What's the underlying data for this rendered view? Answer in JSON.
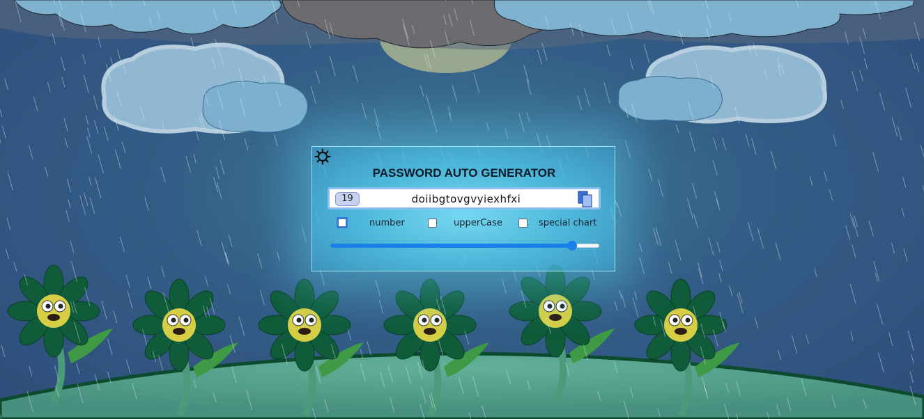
{
  "app": {
    "title": "PASSWORD AUTO GENERATOR",
    "password": "doiibgtovgvyiexhfxi",
    "length": "19",
    "slider_value": 0.9
  },
  "options": [
    {
      "label": "number",
      "checked": false
    },
    {
      "label": "upperCase",
      "checked": false
    },
    {
      "label": "special chart",
      "checked": false
    }
  ],
  "icons": {
    "settings": "gear-icon",
    "copy": "copy-icon"
  },
  "colors": {
    "panel_glow": "#5cc8ea",
    "slider_accent": "#1a7fe8",
    "flower_petal": "#0f5b3a",
    "hill": "#5aa58e"
  }
}
